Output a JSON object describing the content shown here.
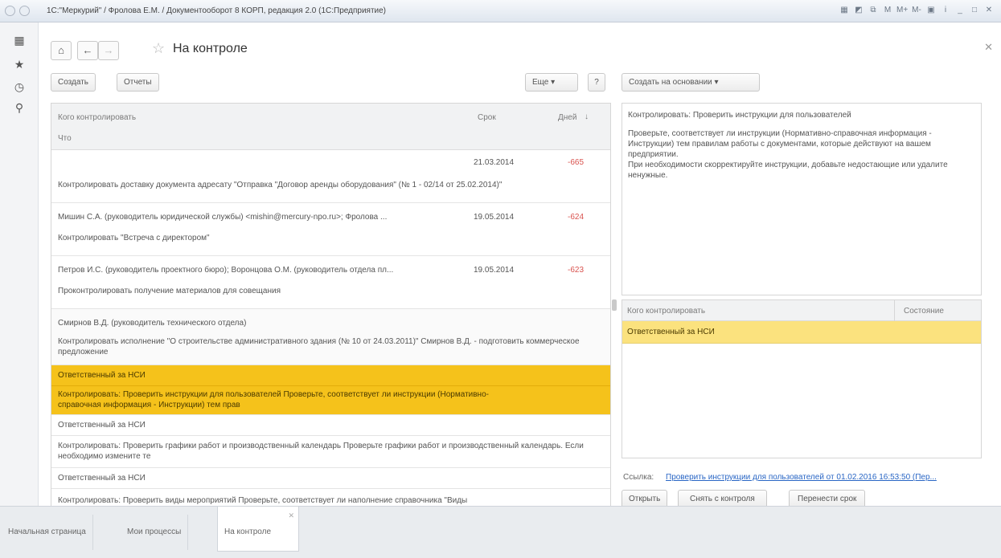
{
  "window": {
    "title": "1С:\"Меркурий\" / Фролова Е.М. / Документооборот 8 КОРП, редакция 2.0 (1С:Предприятие)"
  },
  "icons": {
    "apps": "grid-icon",
    "favorites": "star-icon",
    "history": "history-icon",
    "search": "search-icon",
    "home": "home-icon",
    "back": "arrow-left-icon",
    "forward": "arrow-right-icon",
    "close": "close-icon"
  },
  "toolbar": {
    "title": "На контроле",
    "create": "Создать",
    "reports": "Отчеты",
    "more": "Еще",
    "help": "?",
    "create_based": "Создать на основании"
  },
  "table": {
    "headers": {
      "whom": "Кого контролировать",
      "deadline": "Срок",
      "days": "Дней",
      "sort": "↓",
      "what": "Что"
    },
    "rows": [
      {
        "who": "",
        "date": "21.03.2014",
        "days": "-665",
        "what": "Контролировать доставку документа адресату \"Отправка \"Договор аренды оборудования\" (№ 1 - 02/14 от 25.02.2014)\""
      },
      {
        "who": "Мишин С.А. (руководитель юридической службы) <mishin@mercury-npo.ru>; Фролова ...",
        "date": "19.05.2014",
        "days": "-624",
        "what": "Контролировать \"Встреча с директором\""
      },
      {
        "who": "Петров И.С. (руководитель проектного бюро); Воронцова О.М. (руководитель отдела пл...",
        "date": "19.05.2014",
        "days": "-623",
        "what": "Проконтролировать получение материалов для совещания"
      },
      {
        "who": "Смирнов В.Д. (руководитель технического отдела)",
        "date": "",
        "days": "",
        "what": "Контролировать исполнение \"О строительстве административного здания (№ 10 от 24.03.2011)\" Смирнов В.Д. - подготовить коммерческое предложение"
      },
      {
        "who": "Ответственный за НСИ",
        "date": "",
        "days": "",
        "what": "Контролировать: Проверить инструкции для пользователей Проверьте, соответствует ли инструкции (Нормативно-справочная информация - Инструкции) тем прав"
      },
      {
        "who": "Ответственный за НСИ",
        "date": "",
        "days": "",
        "what": "Контролировать: Проверить графики работ и производственный календарь Проверьте графики работ и производственный календарь. Если необходимо измените те"
      },
      {
        "who": "Ответственный за НСИ",
        "date": "",
        "days": "",
        "what": "Контролировать: Проверить виды мероприятий Проверьте, соответствует ли наполнение справочника \"Виды"
      }
    ]
  },
  "detail": {
    "title": "Контролировать: Проверить инструкции для пользователей",
    "body": "Проверьте, соответствует ли инструкции (Нормативно-справочная информация - Инструкции) тем правилам работы с документами, которые действуют на вашем предприятии.",
    "body2": "При необходимости скорректируйте инструкции, добавьте недостающие или удалите ненужные."
  },
  "subtable": {
    "col1": "Кого контролировать",
    "col2": "Состояние",
    "row_who": "Ответственный за НСИ",
    "row_state": ""
  },
  "link": {
    "label": "Ссылка:",
    "text": "Проверить инструкции для пользователей от 01.02.2016 16:53:50 (Пер..."
  },
  "actions": {
    "open": "Открыть",
    "remove": "Снять с контроля",
    "move": "Перенести срок"
  },
  "tabs": [
    {
      "label": "Начальная страница",
      "active": false
    },
    {
      "label": "Мои процессы",
      "active": false
    },
    {
      "label": "На контроле",
      "active": true
    }
  ],
  "colors": {
    "selection": "#f5c21b",
    "subselection": "#fbe27e",
    "overdue": "#d9534f",
    "link": "#2966c5"
  }
}
